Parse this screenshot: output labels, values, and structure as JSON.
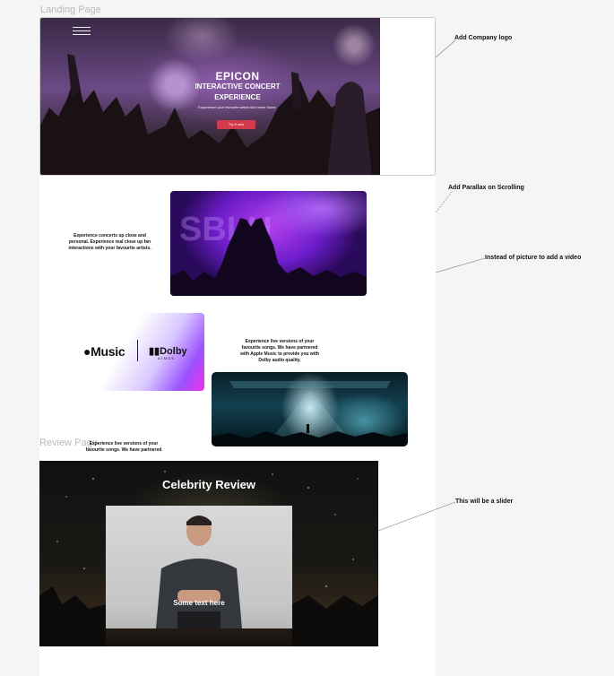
{
  "frames": {
    "landing_label": "Landing Page",
    "review_label": "Review Page"
  },
  "hero": {
    "title": "EPICON",
    "subtitle_line1": "INTERACTIVE CONCERT",
    "subtitle_line2": "EXPERIENCE",
    "tagline": "Experience your favourite artists like never home.",
    "cta": "Try it now"
  },
  "sections": {
    "closeup_text": "Experience concerts up close and personal. Experience real close up fan interactions with your favourite artists.",
    "apple_text": "Experience live versions of your favourite songs. We have partnered with Apple Music to provide you with Dolby audio quality.",
    "overlap_text": "Experience live versions of your favourite songs. We have partnered",
    "music_brand": "Music",
    "dolby_brand": "Dolby",
    "dolby_sub": "ATMOS"
  },
  "review": {
    "title": "Celebrity Review",
    "caption": "Some text here"
  },
  "annotations": {
    "logo": "Add Company logo",
    "parallax": "Add Parallax on Scrolling",
    "video": "Instead of picture to add a video",
    "slider": "This will be a slider"
  },
  "colors": {
    "cta": "#d43a4d",
    "purple": "#b63ff0",
    "teal": "#124050"
  }
}
